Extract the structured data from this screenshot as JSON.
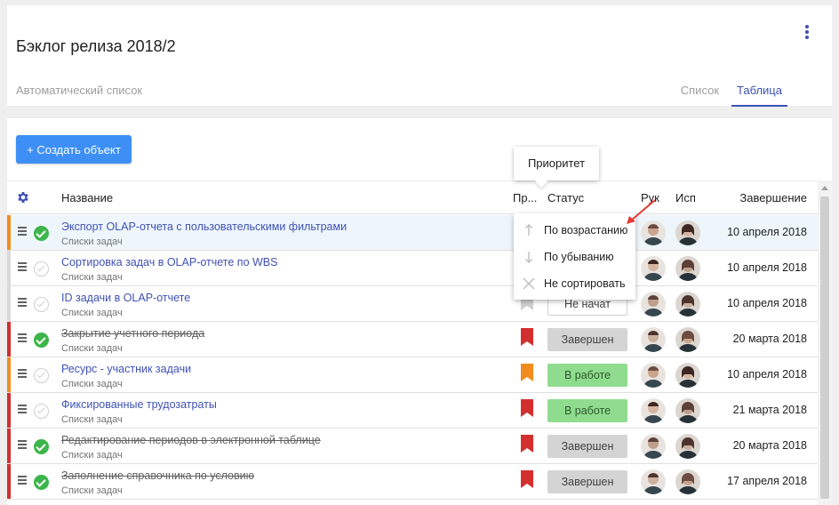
{
  "header": {
    "title": "Бэклог релиза 2018/2",
    "subtitle": "Автоматический список",
    "tabs": [
      {
        "label": "Список",
        "active": false
      },
      {
        "label": "Таблица",
        "active": true
      }
    ]
  },
  "toolbar": {
    "create_label": "+ Создать объект"
  },
  "columns": {
    "name": "Название",
    "priority": "Пр...",
    "status": "Статус",
    "manager": "Рук",
    "executor": "Исп",
    "due": "Завершение"
  },
  "tooltip": {
    "text": "Приоритет"
  },
  "sort_menu": {
    "items": [
      {
        "label": "По возрастанию",
        "icon": "arrow-up-icon"
      },
      {
        "label": "По убыванию",
        "icon": "arrow-down-icon"
      },
      {
        "label": "Не сортировать",
        "icon": "close-icon"
      }
    ]
  },
  "colors": {
    "accent": "#3f51b5",
    "button": "#3d8ff5",
    "done_check": "#3cb54a",
    "priority_high": "#d32f2f",
    "priority_medium": "#f28c1e"
  },
  "rows": [
    {
      "name": "Экспорт OLAP-отчета с пользовательскими фильтрами",
      "sub": "Списки задач",
      "done": true,
      "strike": false,
      "stripe": "#f28c1e",
      "priority": "",
      "status": "",
      "status_type": "",
      "due": "10 апреля 2018"
    },
    {
      "name": "Сортировка задач в OLAP-отчете по WBS",
      "sub": "Списки задач",
      "done": false,
      "strike": false,
      "stripe": "#d9d9d9",
      "priority": "",
      "status": "",
      "status_type": "",
      "due": "10 апреля 2018"
    },
    {
      "name": "ID задачи в OLAP-отчете",
      "sub": "Списки задач",
      "done": false,
      "strike": false,
      "stripe": "#d9d9d9",
      "priority": "low",
      "status": "Не начат",
      "status_type": "new",
      "due": "10 апреля 2018"
    },
    {
      "name": "Закрытие учетного периода",
      "sub": "Списки задач",
      "done": true,
      "strike": true,
      "stripe": "#d32f2f",
      "priority": "high",
      "status": "Завершен",
      "status_type": "done",
      "due": "20 марта 2018"
    },
    {
      "name": "Ресурс - участник задачи",
      "sub": "Списки задач",
      "done": false,
      "strike": false,
      "stripe": "#f28c1e",
      "priority": "medium",
      "status": "В работе",
      "status_type": "work",
      "due": "10 апреля 2018"
    },
    {
      "name": "Фиксированные трудозатраты",
      "sub": "Списки задач",
      "done": false,
      "strike": false,
      "stripe": "#d32f2f",
      "priority": "high",
      "status": "В работе",
      "status_type": "work",
      "due": "21 марта 2018"
    },
    {
      "name": "Редактирование периодов в электронной таблице",
      "sub": "Списки задач",
      "done": true,
      "strike": true,
      "stripe": "#d32f2f",
      "priority": "high",
      "status": "Завершен",
      "status_type": "done",
      "due": "20 марта 2018"
    },
    {
      "name": "Заполнение справочника по условию",
      "sub": "Списки задач",
      "done": true,
      "strike": true,
      "stripe": "#d32f2f",
      "priority": "high",
      "status": "Завершен",
      "status_type": "done",
      "due": "17 апреля 2018"
    }
  ]
}
